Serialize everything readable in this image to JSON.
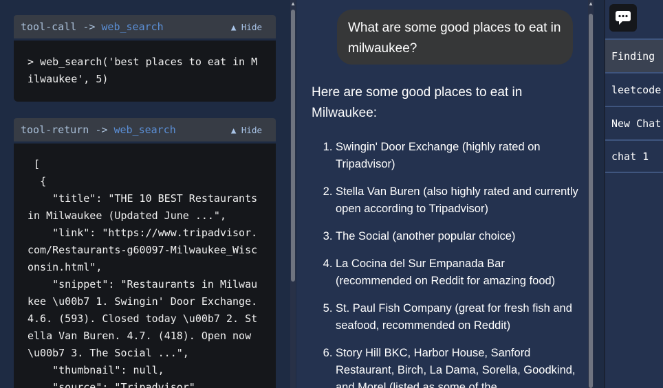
{
  "tool_call": {
    "kind": "tool-call",
    "arrow": "->",
    "fn": "web_search",
    "hide_label": "▲ Hide",
    "body": "> web_search('best places to eat in Milwaukee', 5)"
  },
  "tool_return": {
    "kind": "tool-return",
    "arrow": "->",
    "fn": "web_search",
    "hide_label": "▲ Hide",
    "body": " [\n  {\n    \"title\": \"THE 10 BEST Restaurants in Milwaukee (Updated June ...\",\n    \"link\": \"https://www.tripadvisor.com/Restaurants-g60097-Milwaukee_Wisconsin.html\",\n    \"snippet\": \"Restaurants in Milwaukee \\u00b7 1. Swingin' Door Exchange. 4.6. (593). Closed today \\u00b7 2. Stella Van Buren. 4.7. (418). Open now \\u00b7 3. The Social ...\",\n    \"thumbnail\": null,\n    \"source\": \"Tripadvisor\""
  },
  "chat": {
    "user_message": "What are some good places to eat in milwaukee?",
    "assistant_intro": "Here are some good places to eat in Milwaukee:",
    "assistant_items": [
      "Swingin' Door Exchange (highly rated on Tripadvisor)",
      "Stella Van Buren (also highly rated and currently open according to Tripadvisor)",
      "The Social (another popular choice)",
      "La Cocina del Sur Empanada Bar (recommended on Reddit for amazing food)",
      "St. Paul Fish Company (great for fresh fish and seafood, recommended on Reddit)",
      "Story Hill BKC, Harbor House, Sanford Restaurant, Birch, La Dama, Sorella, Goodkind, and Morel (listed as some of the"
    ]
  },
  "sidebar": {
    "icon": "chat-bubble-icon",
    "sessions": [
      {
        "label": "Finding"
      },
      {
        "label": "leetcode"
      },
      {
        "label": "New Chat"
      },
      {
        "label": "chat 1"
      }
    ]
  },
  "colors": {
    "background": "#1e2b43",
    "chat_panel": "#24324f",
    "code_bg": "#15171b",
    "header_bg": "#373c45",
    "fn_color": "#5b8fd6"
  }
}
